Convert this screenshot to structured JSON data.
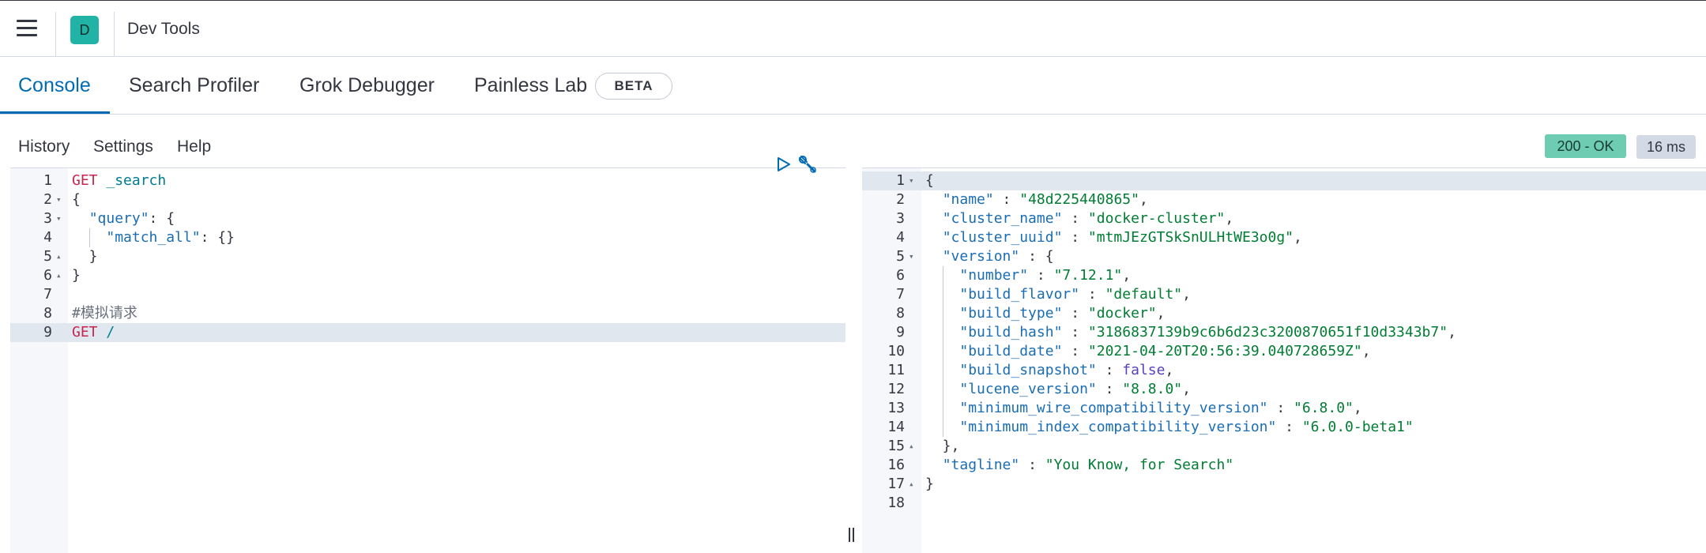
{
  "header": {
    "space_initial": "D",
    "app_title": "Dev Tools"
  },
  "tabs": [
    {
      "label": "Console",
      "selected": true
    },
    {
      "label": "Search Profiler",
      "selected": false
    },
    {
      "label": "Grok Debugger",
      "selected": false
    },
    {
      "label": "Painless Lab",
      "selected": false,
      "badge": "BETA"
    }
  ],
  "toolbar": {
    "history": "History",
    "settings": "Settings",
    "help": "Help"
  },
  "status": {
    "code": "200 - OK",
    "time": "16 ms",
    "ok_color": "#6dccb1"
  },
  "request_editor": {
    "lines": [
      {
        "n": "1",
        "fold": "",
        "segments": [
          {
            "t": "GET",
            "c": "k-method"
          },
          {
            "t": " _search",
            "c": "k-path"
          }
        ]
      },
      {
        "n": "2",
        "fold": "▾",
        "segments": [
          {
            "t": "{",
            "c": ""
          }
        ]
      },
      {
        "n": "3",
        "fold": "▾",
        "segments": [
          {
            "t": "  ",
            "c": ""
          },
          {
            "t": "\"query\"",
            "c": "k-key"
          },
          {
            "t": ": {",
            "c": ""
          }
        ]
      },
      {
        "n": "4",
        "fold": "",
        "segments": [
          {
            "t": "    ",
            "c": ""
          },
          {
            "t": "\"match_all\"",
            "c": "k-key"
          },
          {
            "t": ": {}",
            "c": ""
          }
        ]
      },
      {
        "n": "5",
        "fold": "▴",
        "segments": [
          {
            "t": "  }",
            "c": ""
          }
        ]
      },
      {
        "n": "6",
        "fold": "▴",
        "segments": [
          {
            "t": "}",
            "c": ""
          }
        ]
      },
      {
        "n": "7",
        "fold": "",
        "segments": []
      },
      {
        "n": "8",
        "fold": "",
        "segments": [
          {
            "t": "#模拟请求",
            "c": "k-comment"
          }
        ]
      },
      {
        "n": "9",
        "fold": "",
        "segments": [
          {
            "t": "GET",
            "c": "k-method"
          },
          {
            "t": " /",
            "c": "k-path"
          }
        ],
        "active": true
      }
    ]
  },
  "response_editor": {
    "lines": [
      {
        "n": "1",
        "fold": "▾",
        "segments": [
          {
            "t": "{",
            "c": ""
          }
        ],
        "active": true
      },
      {
        "n": "2",
        "fold": "",
        "segments": [
          {
            "t": "  ",
            "c": ""
          },
          {
            "t": "\"name\"",
            "c": "k-key"
          },
          {
            "t": " : ",
            "c": ""
          },
          {
            "t": "\"48d225440865\"",
            "c": "k-str"
          },
          {
            "t": ",",
            "c": ""
          }
        ]
      },
      {
        "n": "3",
        "fold": "",
        "segments": [
          {
            "t": "  ",
            "c": ""
          },
          {
            "t": "\"cluster_name\"",
            "c": "k-key"
          },
          {
            "t": " : ",
            "c": ""
          },
          {
            "t": "\"docker-cluster\"",
            "c": "k-str"
          },
          {
            "t": ",",
            "c": ""
          }
        ]
      },
      {
        "n": "4",
        "fold": "",
        "segments": [
          {
            "t": "  ",
            "c": ""
          },
          {
            "t": "\"cluster_uuid\"",
            "c": "k-key"
          },
          {
            "t": " : ",
            "c": ""
          },
          {
            "t": "\"mtmJEzGTSkSnULHtWE3o0g\"",
            "c": "k-str"
          },
          {
            "t": ",",
            "c": ""
          }
        ]
      },
      {
        "n": "5",
        "fold": "▾",
        "segments": [
          {
            "t": "  ",
            "c": ""
          },
          {
            "t": "\"version\"",
            "c": "k-key"
          },
          {
            "t": " : {",
            "c": ""
          }
        ]
      },
      {
        "n": "6",
        "fold": "",
        "segments": [
          {
            "t": "    ",
            "c": ""
          },
          {
            "t": "\"number\"",
            "c": "k-key"
          },
          {
            "t": " : ",
            "c": ""
          },
          {
            "t": "\"7.12.1\"",
            "c": "k-str"
          },
          {
            "t": ",",
            "c": ""
          }
        ]
      },
      {
        "n": "7",
        "fold": "",
        "segments": [
          {
            "t": "    ",
            "c": ""
          },
          {
            "t": "\"build_flavor\"",
            "c": "k-key"
          },
          {
            "t": " : ",
            "c": ""
          },
          {
            "t": "\"default\"",
            "c": "k-str"
          },
          {
            "t": ",",
            "c": ""
          }
        ]
      },
      {
        "n": "8",
        "fold": "",
        "segments": [
          {
            "t": "    ",
            "c": ""
          },
          {
            "t": "\"build_type\"",
            "c": "k-key"
          },
          {
            "t": " : ",
            "c": ""
          },
          {
            "t": "\"docker\"",
            "c": "k-str"
          },
          {
            "t": ",",
            "c": ""
          }
        ]
      },
      {
        "n": "9",
        "fold": "",
        "segments": [
          {
            "t": "    ",
            "c": ""
          },
          {
            "t": "\"build_hash\"",
            "c": "k-key"
          },
          {
            "t": " : ",
            "c": ""
          },
          {
            "t": "\"3186837139b9c6b6d23c3200870651f10d3343b7\"",
            "c": "k-str"
          },
          {
            "t": ",",
            "c": ""
          }
        ]
      },
      {
        "n": "10",
        "fold": "",
        "segments": [
          {
            "t": "    ",
            "c": ""
          },
          {
            "t": "\"build_date\"",
            "c": "k-key"
          },
          {
            "t": " : ",
            "c": ""
          },
          {
            "t": "\"2021-04-20T20:56:39.040728659Z\"",
            "c": "k-str"
          },
          {
            "t": ",",
            "c": ""
          }
        ]
      },
      {
        "n": "11",
        "fold": "",
        "segments": [
          {
            "t": "    ",
            "c": ""
          },
          {
            "t": "\"build_snapshot\"",
            "c": "k-key"
          },
          {
            "t": " : ",
            "c": ""
          },
          {
            "t": "false",
            "c": "k-bool"
          },
          {
            "t": ",",
            "c": ""
          }
        ]
      },
      {
        "n": "12",
        "fold": "",
        "segments": [
          {
            "t": "    ",
            "c": ""
          },
          {
            "t": "\"lucene_version\"",
            "c": "k-key"
          },
          {
            "t": " : ",
            "c": ""
          },
          {
            "t": "\"8.8.0\"",
            "c": "k-str"
          },
          {
            "t": ",",
            "c": ""
          }
        ]
      },
      {
        "n": "13",
        "fold": "",
        "segments": [
          {
            "t": "    ",
            "c": ""
          },
          {
            "t": "\"minimum_wire_compatibility_version\"",
            "c": "k-key"
          },
          {
            "t": " : ",
            "c": ""
          },
          {
            "t": "\"6.8.0\"",
            "c": "k-str"
          },
          {
            "t": ",",
            "c": ""
          }
        ]
      },
      {
        "n": "14",
        "fold": "",
        "segments": [
          {
            "t": "    ",
            "c": ""
          },
          {
            "t": "\"minimum_index_compatibility_version\"",
            "c": "k-key"
          },
          {
            "t": " : ",
            "c": ""
          },
          {
            "t": "\"6.0.0-beta1\"",
            "c": "k-str"
          }
        ]
      },
      {
        "n": "15",
        "fold": "▴",
        "segments": [
          {
            "t": "  },",
            "c": ""
          }
        ]
      },
      {
        "n": "16",
        "fold": "",
        "segments": [
          {
            "t": "  ",
            "c": ""
          },
          {
            "t": "\"tagline\"",
            "c": "k-key"
          },
          {
            "t": " : ",
            "c": ""
          },
          {
            "t": "\"You Know, for Search\"",
            "c": "k-str"
          }
        ]
      },
      {
        "n": "17",
        "fold": "▴",
        "segments": [
          {
            "t": "}",
            "c": ""
          }
        ]
      },
      {
        "n": "18",
        "fold": "",
        "segments": []
      }
    ]
  },
  "icons": {
    "menu": "hamburger-icon",
    "run": "play-icon",
    "wrench": "wrench-icon",
    "resize": "pane-resize-icon"
  }
}
